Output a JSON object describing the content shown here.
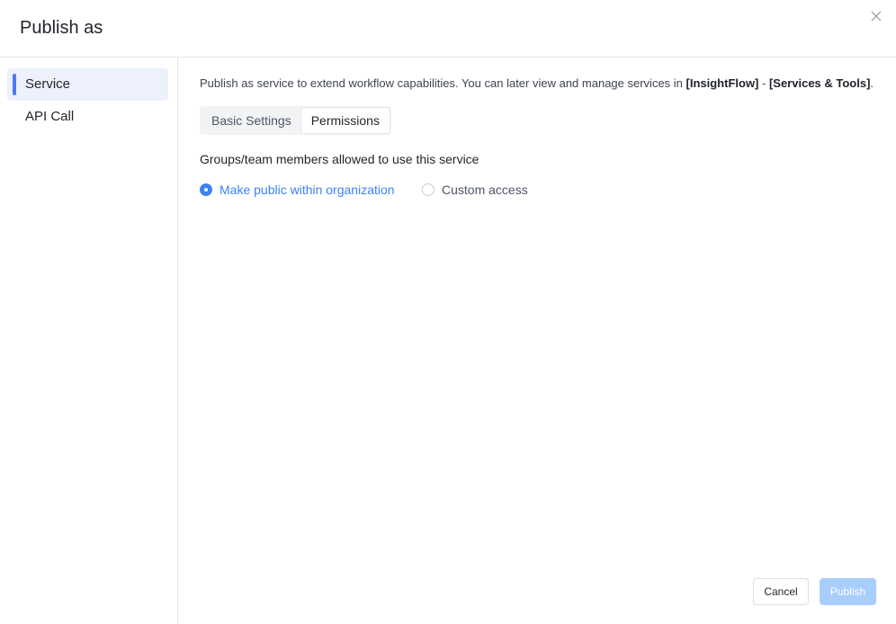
{
  "dialog": {
    "title": "Publish as",
    "close_icon": "close-icon"
  },
  "sidebar": {
    "items": [
      {
        "label": "Service",
        "active": true
      },
      {
        "label": "API Call",
        "active": false
      }
    ]
  },
  "main": {
    "description": {
      "text": "Publish as service to extend workflow capabilities. You can later view and manage services in ",
      "link1": "[InsightFlow]",
      "separator": " - ",
      "link2": "[Services & Tools]",
      "end": "."
    },
    "tabs": [
      {
        "label": "Basic Settings",
        "active": false
      },
      {
        "label": "Permissions",
        "active": true
      }
    ],
    "permissions": {
      "section_label": "Groups/team members allowed to use this service",
      "options": [
        {
          "label": "Make public within organization",
          "checked": true
        },
        {
          "label": "Custom access",
          "checked": false
        }
      ]
    }
  },
  "footer": {
    "cancel_label": "Cancel",
    "publish_label": "Publish"
  },
  "colors": {
    "accent": "#4f79f0",
    "radio_checked": "#3b82f6",
    "publish_disabled": "#a9cdfc",
    "sidebar_active_bg": "#edf1fc"
  }
}
